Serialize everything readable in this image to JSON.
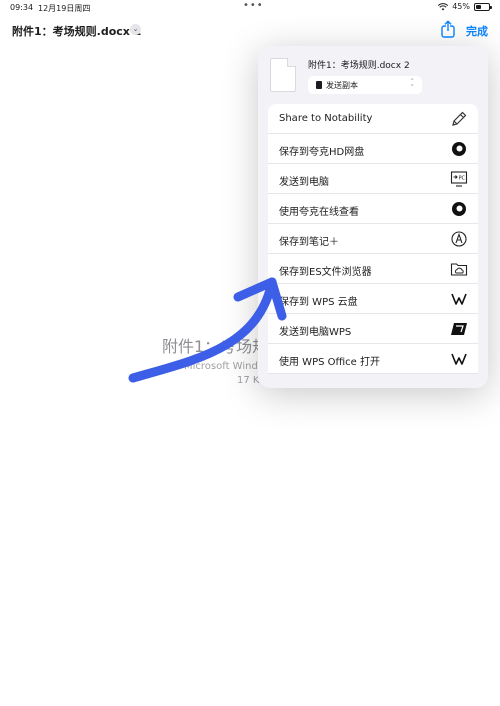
{
  "status_bar": {
    "time": "09:34",
    "date": "12月19日周四",
    "battery": "45%",
    "battery_level": 0.45
  },
  "nav": {
    "title": "附件1：考场规则.docx 2",
    "done_label": "完成"
  },
  "document": {
    "name": "附件1：考场规",
    "app": "Microsoft Windo",
    "size": "17 KB"
  },
  "sheet": {
    "file_name": "附件1：考场规则.docx 2",
    "mode_label": "发送副本",
    "actions": [
      {
        "label": "Share to Notability",
        "icon": "pencil-icon"
      },
      {
        "label": "保存到夸克HD网盘",
        "icon": "quark-icon"
      },
      {
        "label": "发送到电脑",
        "icon": "send-to-pc-icon"
      },
      {
        "label": "使用夸克在线查看",
        "icon": "quark-icon"
      },
      {
        "label": "保存到笔记＋",
        "icon": "pen-nib-icon"
      },
      {
        "label": "保存到ES文件浏览器",
        "icon": "folder-cloud-icon"
      },
      {
        "label": "保存到 WPS 云盘",
        "icon": "wps-icon"
      },
      {
        "label": "发送到电脑WPS",
        "icon": "wps-pc-icon"
      },
      {
        "label": "使用 WPS Office 打开",
        "icon": "wps-icon"
      }
    ]
  },
  "colors": {
    "accent": "#0a84ff",
    "annotation_arrow": "#3d5ee6"
  }
}
